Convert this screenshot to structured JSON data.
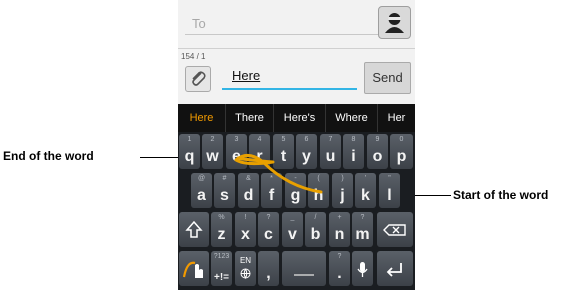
{
  "compose": {
    "to_placeholder": "To",
    "counter": "154 / 1",
    "message_text": "Here",
    "send_label": "Send"
  },
  "suggestions": [
    "Here",
    "There",
    "Here's",
    "Where",
    "Her"
  ],
  "keyboard": {
    "row1": [
      {
        "main": "q",
        "hint": "1"
      },
      {
        "main": "w",
        "hint": "2"
      },
      {
        "main": "e",
        "hint": "3"
      },
      {
        "main": "r",
        "hint": "4"
      },
      {
        "main": "t",
        "hint": "5"
      },
      {
        "main": "y",
        "hint": "6"
      },
      {
        "main": "u",
        "hint": "7"
      },
      {
        "main": "i",
        "hint": "8"
      },
      {
        "main": "o",
        "hint": "9"
      },
      {
        "main": "p",
        "hint": "0"
      }
    ],
    "row2": [
      {
        "main": "a",
        "hint": "@"
      },
      {
        "main": "s",
        "hint": "#"
      },
      {
        "main": "d",
        "hint": "&"
      },
      {
        "main": "f",
        "hint": "*"
      },
      {
        "main": "g",
        "hint": "-"
      },
      {
        "main": "h",
        "hint": "("
      },
      {
        "main": "j",
        "hint": ")"
      },
      {
        "main": "k",
        "hint": "'"
      },
      {
        "main": "l",
        "hint": "\""
      }
    ],
    "row3": [
      {
        "main": "z",
        "hint": "%"
      },
      {
        "main": "x",
        "hint": "!"
      },
      {
        "main": "c",
        "hint": "?"
      },
      {
        "main": "v",
        "hint": "_"
      },
      {
        "main": "b",
        "hint": "/"
      },
      {
        "main": "n",
        "hint": "+"
      },
      {
        "main": "m",
        "hint": "?"
      }
    ],
    "symbols_hint": "?123",
    "symbols_main": "+!=",
    "lang_label": "EN",
    "comma": ",",
    "period": ".",
    "period_hint": "?"
  },
  "annotations": {
    "end_label": "End of the word",
    "start_label": "Start of the word"
  },
  "colors": {
    "accent": "#33b5e5",
    "suggestion_active": "#f29a00",
    "trail": "#e8a000"
  }
}
